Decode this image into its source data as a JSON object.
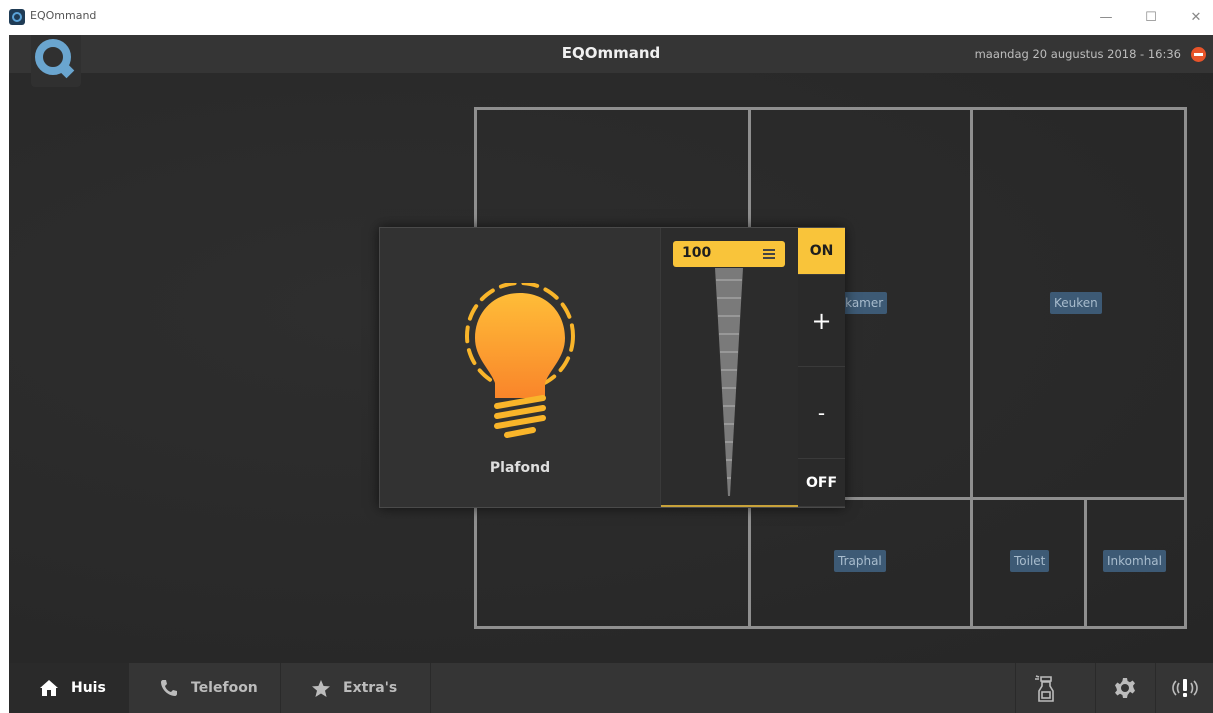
{
  "window": {
    "title": "EQOmmand",
    "minimize_glyph": "—",
    "maximize_glyph": "☐",
    "close_glyph": "✕"
  },
  "header": {
    "title": "EQOmmand",
    "datetime": "maandag 20 augustus 2018 - 16:36"
  },
  "floorplan": {
    "rooms": [
      {
        "label": "etkamer"
      },
      {
        "label": "Keuken"
      },
      {
        "label": "Traphal"
      },
      {
        "label": "Toilet"
      },
      {
        "label": "Inkomhal"
      }
    ]
  },
  "light_popup": {
    "device_name": "Plafond",
    "dim_value": "100",
    "dim_level_percent": 100,
    "on_label": "ON",
    "plus_label": "+",
    "minus_label": "-",
    "off_label": "OFF",
    "accent_color": "#f9c43a"
  },
  "bottom_nav": {
    "tabs": [
      {
        "label": "Huis",
        "icon": "home-icon",
        "active": true
      },
      {
        "label": "Telefoon",
        "icon": "phone-icon",
        "active": false
      },
      {
        "label": "Extra's",
        "icon": "star-icon",
        "active": false
      }
    ],
    "buttons": [
      {
        "icon": "spray-bottle-icon"
      },
      {
        "icon": "gear-icon"
      },
      {
        "icon": "alarm-icon"
      }
    ]
  },
  "colors": {
    "accent": "#f9c43a",
    "room_label_bg": "#3d5a75",
    "logout": "#e8542a",
    "logo": "#6aa5cf"
  }
}
